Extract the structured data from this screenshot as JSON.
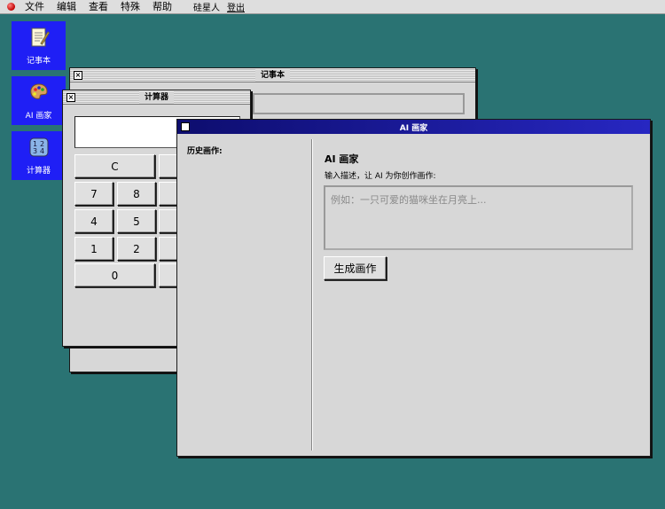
{
  "menubar": {
    "items": [
      "文件",
      "编辑",
      "查看",
      "特殊",
      "帮助"
    ],
    "user": "硅星人",
    "logout": "登出"
  },
  "desktop": {
    "icons": [
      {
        "label": "记事本",
        "icon": "notepad-icon"
      },
      {
        "label": "AI 画家",
        "icon": "palette-icon"
      },
      {
        "label": "计算器",
        "icon": "calculator-icon"
      }
    ]
  },
  "notepad": {
    "title": "记事本"
  },
  "calculator": {
    "title": "计算器",
    "display": "",
    "buttons": [
      "C",
      "7",
      "8",
      "4",
      "5",
      "1",
      "2",
      "0"
    ]
  },
  "ai": {
    "title": "AI 画家",
    "history_label": "历史画作:",
    "heading": "AI 画家",
    "instruction": "输入描述，让 AI 为你创作画作:",
    "placeholder": "例如：一只可爱的猫咪坐在月亮上...",
    "generate_button": "生成画作"
  },
  "colors": {
    "desktop": "#2a7373",
    "icon_bg": "#1f1ff5",
    "active_title_start": "#0d0d6e",
    "active_title_end": "#2727c2"
  }
}
